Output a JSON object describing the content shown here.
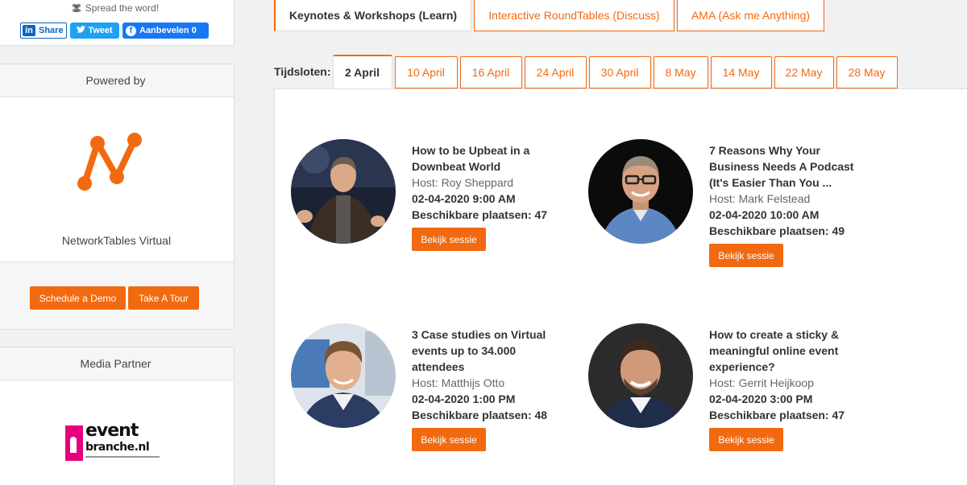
{
  "sidebar": {
    "spread_text": "Spread the word!",
    "share_buttons": {
      "linkedin": "Share",
      "twitter": "Tweet",
      "facebook": "Aanbevelen 0"
    },
    "powered_by": {
      "heading": "Powered by",
      "company": "NetworkTables Virtual",
      "demo_button": "Schedule a Demo",
      "tour_button": "Take A Tour"
    },
    "media_partner": {
      "heading": "Media Partner",
      "logo_word1": "event",
      "logo_word2": "branche.nl"
    }
  },
  "tabs": [
    {
      "label": "Keynotes & Workshops (Learn)",
      "active": true
    },
    {
      "label": "Interactive RoundTables (Discuss)",
      "active": false
    },
    {
      "label": "AMA (Ask me Anything)",
      "active": false
    }
  ],
  "dates": {
    "label": "Tijdsloten:",
    "items": [
      "2 April",
      "10 April",
      "16 April",
      "24 April",
      "30 April",
      "8 May",
      "14 May",
      "22 May",
      "28 May"
    ],
    "active_index": 0
  },
  "sessions": [
    {
      "title": "How to be Upbeat in a Downbeat World",
      "host": "Host: Roy Sheppard",
      "datetime": "02-04-2020 9:00 AM",
      "seats": "Beschikbare plaatsen: 47",
      "button": "Bekijk sessie"
    },
    {
      "title": "7 Reasons Why Your Business Needs A Podcast (It's Easier Than You ...",
      "host": "Host: Mark Felstead",
      "datetime": "02-04-2020 10:00 AM",
      "seats": "Beschikbare plaatsen: 49",
      "button": "Bekijk sessie"
    },
    {
      "title": "3 Case studies on Virtual events up to 34.000 attendees",
      "host": "Host: Matthijs Otto",
      "datetime": "02-04-2020 1:00 PM",
      "seats": "Beschikbare plaatsen: 48",
      "button": "Bekijk sessie"
    },
    {
      "title": "How to create a sticky & meaningful online event experience?",
      "host": "Host: Gerrit Heijkoop",
      "datetime": "02-04-2020 3:00 PM",
      "seats": "Beschikbare plaatsen: 47",
      "button": "Bekijk sessie"
    }
  ],
  "colors": {
    "accent": "#f26a10",
    "linkedin": "#0a66c2",
    "twitter": "#1da1f2",
    "facebook": "#1877f2",
    "eventbranche": "#e6007e"
  }
}
